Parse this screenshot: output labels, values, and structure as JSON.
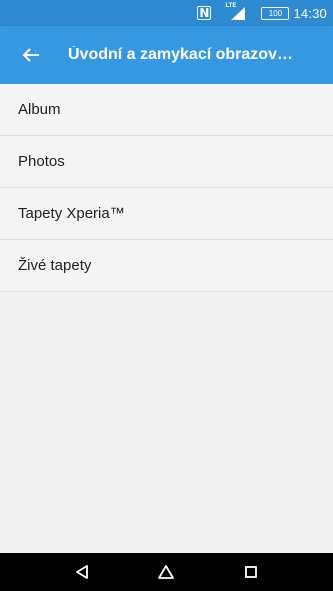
{
  "status_bar": {
    "nfc": "N",
    "network": "LTE",
    "battery": "100",
    "time": "14:30"
  },
  "header": {
    "title": "Úvodní a zamykací obrazov…",
    "back_icon": "arrow-left-icon"
  },
  "list": {
    "items": [
      {
        "label": "Album"
      },
      {
        "label": "Photos"
      },
      {
        "label": "Tapety Xperia™"
      },
      {
        "label": "Živé tapety"
      }
    ]
  },
  "nav_bar": {
    "back_icon": "triangle-back-icon",
    "home_icon": "home-icon",
    "recents_icon": "square-recents-icon"
  },
  "colors": {
    "status_bar": "#2e8bd1",
    "app_bar": "#3798e2",
    "background": "#f1f1f1",
    "nav_bar": "#000000"
  }
}
